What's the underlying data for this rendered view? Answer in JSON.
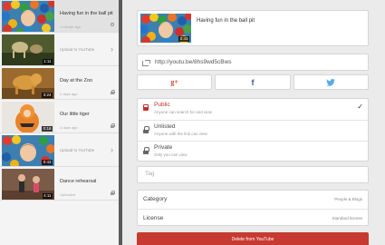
{
  "videos": [
    {
      "title": "Having fun in the ball pit",
      "meta": "1 minute ago",
      "status_icon": "clock-icon",
      "selected": true
    },
    {
      "subtitle": "Upload to YouTube",
      "duration": "1:11",
      "chevron": true
    },
    {
      "title": "Day at the Zoo",
      "duration": "3:24",
      "meta": "2 days ago",
      "status_icon": "lock-icon"
    },
    {
      "title": "Our little tiger",
      "duration": "0:16",
      "meta": "3 days ago",
      "status_icon": "lock-icon"
    },
    {
      "subtitle": "Upload to YouTube",
      "duration": "0:43",
      "chevron": true
    },
    {
      "title": "Dance rehearsal",
      "duration": "4:11",
      "meta": "Uploaded",
      "status_icon": "lock-icon"
    }
  ],
  "detail": {
    "title": "Having fun in the ball pit",
    "duration": "0:43",
    "url": "http://youtu.be/8hs9wd5cBws",
    "share_icon": "share-icon"
  },
  "social": {
    "google": "g+",
    "facebook": "f",
    "twitter_icon": "twitter-bird-icon"
  },
  "privacy": [
    {
      "label": "Public",
      "desc": "Anyone can search for and view",
      "icon": "youtube-icon",
      "selected": true
    },
    {
      "label": "Unlisted",
      "desc": "Anyone with the link can view",
      "icon": "lock-icon"
    },
    {
      "label": "Private",
      "desc": "Only you can view",
      "icon": "lock-icon"
    }
  ],
  "tag_placeholder": "Tag",
  "category": {
    "label": "Category",
    "value": "People & Blogs"
  },
  "license": {
    "label": "License",
    "value": "Standard license"
  },
  "delete_label": "Delete from YouTube",
  "colors": {
    "youtube_red": "#c4302b",
    "divider": "#5a5a5a",
    "facebook": "#3b5998",
    "google": "#d14836",
    "twitter": "#55acee"
  }
}
